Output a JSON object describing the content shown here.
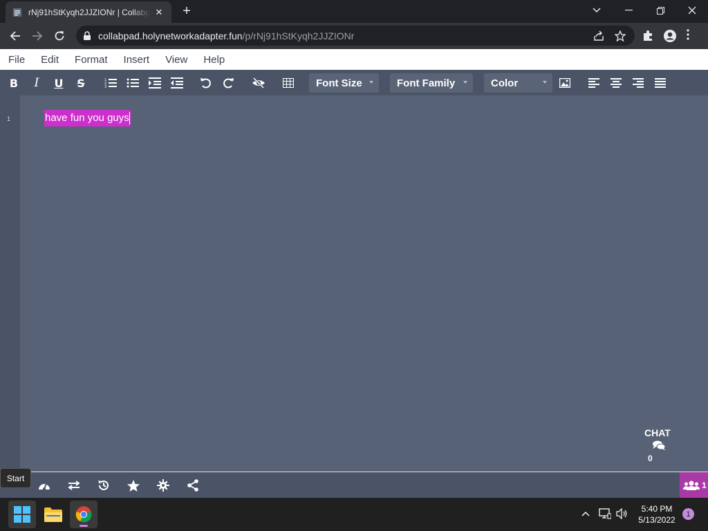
{
  "browser": {
    "tab_title": "rNj91hStKyqh2JJZIONr | Collabpad",
    "tab_close": "✕",
    "new_tab": "+",
    "url_host": "collabpad.holynetworkadapter.fun",
    "url_path": "/p/rNj91hStKyqh2JJZIONr"
  },
  "menu": {
    "items": [
      "File",
      "Edit",
      "Format",
      "Insert",
      "View",
      "Help"
    ]
  },
  "toolbar": {
    "bold": "B",
    "italic": "I",
    "underline": "U",
    "strikethrough": "S",
    "font_size": "Font Size",
    "font_family": "Font Family",
    "color": "Color"
  },
  "editor": {
    "line_number": "1",
    "text": "have fun you guys",
    "highlight_color": "#cc2fcb"
  },
  "chat": {
    "label": "CHAT",
    "count": "0"
  },
  "status": {
    "user_count": "1",
    "tooltip": "Start"
  },
  "taskbar": {
    "time": "5:40 PM",
    "date": "5/13/2022",
    "notifications": "1"
  },
  "colors": {
    "accent": "#a93aa5",
    "toolbar_bg": "#4a5466",
    "editor_bg": "#576276"
  }
}
